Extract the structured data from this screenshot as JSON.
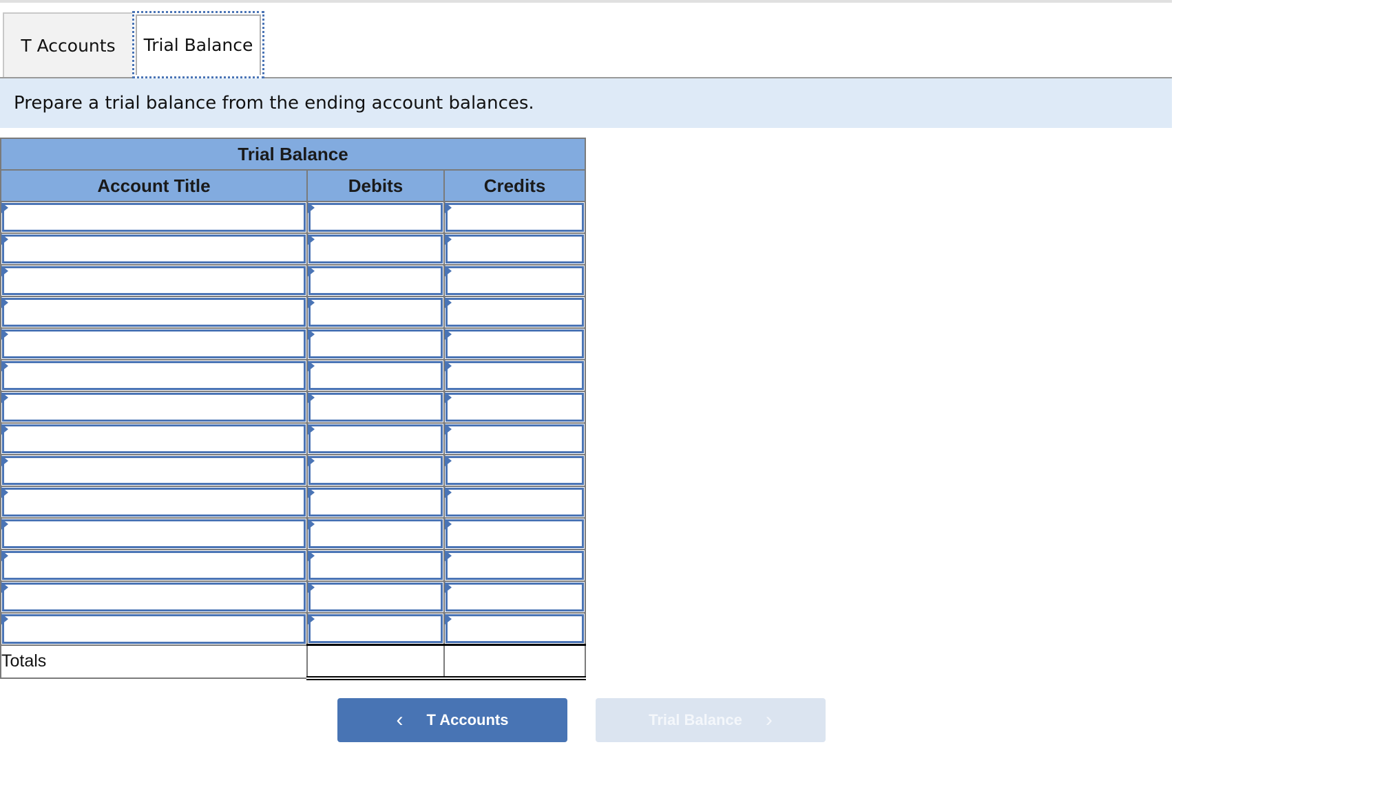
{
  "tabs": [
    {
      "label": "T Accounts",
      "active": false
    },
    {
      "label": "Trial Balance",
      "active": true
    }
  ],
  "instruction": "Prepare a trial balance from the ending account balances.",
  "trial_balance": {
    "title": "Trial Balance",
    "columns": [
      "Account Title",
      "Debits",
      "Credits"
    ],
    "rows": [
      {
        "account": "",
        "debit": "",
        "credit": ""
      },
      {
        "account": "",
        "debit": "",
        "credit": ""
      },
      {
        "account": "",
        "debit": "",
        "credit": ""
      },
      {
        "account": "",
        "debit": "",
        "credit": ""
      },
      {
        "account": "",
        "debit": "",
        "credit": ""
      },
      {
        "account": "",
        "debit": "",
        "credit": ""
      },
      {
        "account": "",
        "debit": "",
        "credit": ""
      },
      {
        "account": "",
        "debit": "",
        "credit": ""
      },
      {
        "account": "",
        "debit": "",
        "credit": ""
      },
      {
        "account": "",
        "debit": "",
        "credit": ""
      },
      {
        "account": "",
        "debit": "",
        "credit": ""
      },
      {
        "account": "",
        "debit": "",
        "credit": ""
      },
      {
        "account": "",
        "debit": "",
        "credit": ""
      },
      {
        "account": "",
        "debit": "",
        "credit": ""
      }
    ],
    "totals_label": "Totals",
    "total_debit": "",
    "total_credit": ""
  },
  "nav": {
    "prev_label": "T Accounts",
    "prev_icon": "chevron-left-icon",
    "next_label": "Trial Balance",
    "next_icon": "chevron-right-icon",
    "next_disabled": true
  },
  "colors": {
    "accent": "#4874b4",
    "header_bg": "#82abdf",
    "instruction_bg": "#deeaf7",
    "disabled_bg": "#dbe4f0"
  }
}
